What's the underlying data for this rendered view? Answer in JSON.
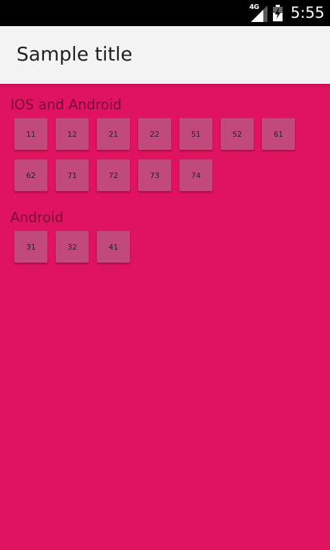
{
  "status_bar": {
    "network": "4G",
    "time": "5:55",
    "icons": [
      "signal-icon",
      "battery-charging-icon"
    ]
  },
  "app_bar": {
    "title": "Sample title"
  },
  "sections": [
    {
      "label": "IOS and Android",
      "tiles": [
        "11",
        "12",
        "21",
        "22",
        "51",
        "52",
        "61",
        "62",
        "71",
        "72",
        "73",
        "74"
      ]
    },
    {
      "label": "Android",
      "tiles": [
        "31",
        "32",
        "41"
      ]
    }
  ],
  "colors": {
    "background": "#e0135f",
    "tile": "#c2497c",
    "app_bar": "#f4f4f4",
    "section_label": "#7a0a3a"
  }
}
